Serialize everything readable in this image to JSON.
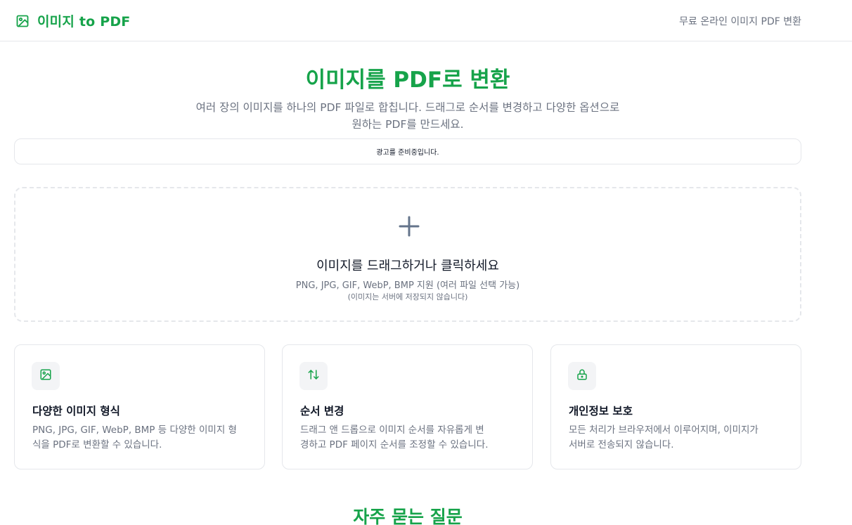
{
  "header": {
    "logo_text": "이미지 to PDF",
    "tagline": "무료 온라인 이미지 PDF 변환"
  },
  "hero": {
    "title": "이미지를 PDF로 변환",
    "description_line1": "여러 장의 이미지를 하나의 PDF 파일로 합칩니다. 드래그로 순서를 변경하고 다양한 옵션으로",
    "description_line2": "원하는 PDF를 만드세요."
  },
  "ad": {
    "text": "광고를 준비중입니다."
  },
  "dropzone": {
    "title": "이미지를 드래그하거나 클릭하세요",
    "formats": "PNG, JPG, GIF, WebP, BMP 지원 (여러 파일 선택 가능)",
    "note": "(이미지는 서버에 저장되지 않습니다)"
  },
  "features": [
    {
      "icon": "image-icon",
      "title": "다양한 이미지 형식",
      "desc_line1": "PNG, JPG, GIF, WebP, BMP 등 다양한 이미지 형",
      "desc_line2": "식을 PDF로 변환할 수 있습니다."
    },
    {
      "icon": "swap-arrows-icon",
      "title": "순서 변경",
      "desc_line1": "드래그 앤 드롭으로 이미지 순서를 자유롭게 변",
      "desc_line2": "경하고 PDF 페이지 순서를 조정할 수 있습니다."
    },
    {
      "icon": "lock-icon",
      "title": "개인정보 보호",
      "desc_line1": "모든 처리가 브라우저에서 이루어지며, 이미지가",
      "desc_line2": "서버로 전송되지 않습니다."
    }
  ],
  "faq": {
    "title": "자주 묻는 질문"
  },
  "colors": {
    "accent": "#16a34a",
    "muted_text": "#6b7280",
    "border": "#e5e7eb"
  }
}
